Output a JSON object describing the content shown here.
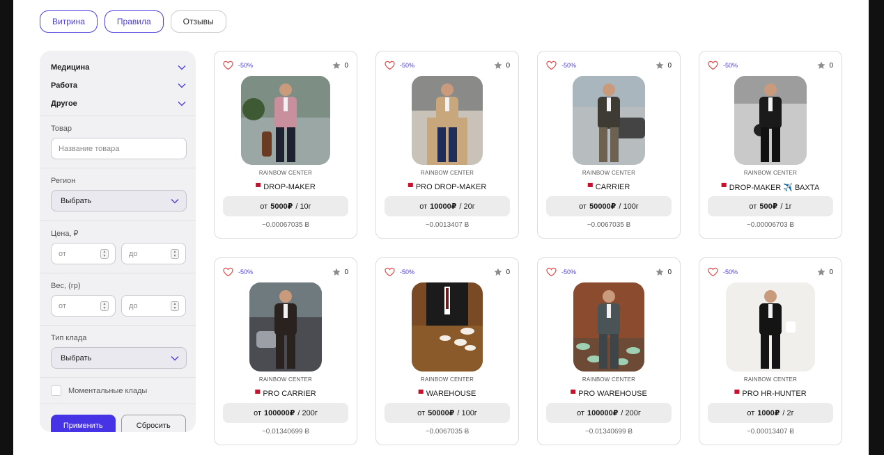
{
  "tabs": [
    {
      "label": "Витрина",
      "active": true
    },
    {
      "label": "Правила",
      "active": true
    },
    {
      "label": "Отзывы",
      "active": false
    }
  ],
  "sidebar": {
    "categories": [
      "Медицина",
      "Работа",
      "Другое"
    ],
    "product": {
      "label": "Товар",
      "placeholder": "Название товара"
    },
    "region": {
      "label": "Регион",
      "value": "Выбрать"
    },
    "price": {
      "label": "Цена, ₽",
      "from": "от",
      "to": "до"
    },
    "weight": {
      "label": "Вес, (гр)",
      "from": "от",
      "to": "до"
    },
    "stash_type": {
      "label": "Тип клада",
      "value": "Выбрать"
    },
    "instant": {
      "label": "Моментальные клады",
      "checked": false
    },
    "apply_label": "Применить",
    "reset_label": "Сбросить"
  },
  "products": [
    {
      "discount": "-50%",
      "rating": "0",
      "shop": "RAINBOW CENTER",
      "name": "DROP-MAKER",
      "price_prefix": "от",
      "price": "5000₽",
      "price_suffix": "/ 10г",
      "crypto": "~0.00067035 Ƀ",
      "photo": "man-pink-shirt"
    },
    {
      "discount": "-50%",
      "rating": "0",
      "shop": "RAINBOW CENTER",
      "name": "PRO DROP-MAKER",
      "price_prefix": "от",
      "price": "10000₽",
      "price_suffix": "/ 20г",
      "crypto": "~0.0013407 Ƀ",
      "photo": "man-beige-coat"
    },
    {
      "discount": "-50%",
      "rating": "0",
      "shop": "RAINBOW CENTER",
      "name": "CARRIER",
      "price_prefix": "от",
      "price": "50000₽",
      "price_suffix": "/ 100г",
      "crypto": "~0.0067035 Ƀ",
      "photo": "man-vest-car"
    },
    {
      "discount": "-50%",
      "rating": "0",
      "shop": "RAINBOW CENTER",
      "name": "DROP-MAKER ✈️ ВАХТА",
      "price_prefix": "от",
      "price": "500₽",
      "price_suffix": "/ 1г",
      "crypto": "~0.00006703 Ƀ",
      "photo": "man-black-street"
    },
    {
      "discount": "-50%",
      "rating": "0",
      "shop": "RAINBOW CENTER",
      "name": "PRO CARRIER",
      "price_prefix": "от",
      "price": "100000₽",
      "price_suffix": "/ 200г",
      "crypto": "~0.01340699 Ƀ",
      "photo": "man-dark-suit"
    },
    {
      "discount": "-50%",
      "rating": "0",
      "shop": "RAINBOW CENTER",
      "name": "WAREHOUSE",
      "price_prefix": "от",
      "price": "50000₽",
      "price_suffix": "/ 100г",
      "crypto": "~0.0067035 Ƀ",
      "photo": "table-coffee"
    },
    {
      "discount": "-50%",
      "rating": "0",
      "shop": "RAINBOW CENTER",
      "name": "PRO WAREHOUSE",
      "price_prefix": "от",
      "price": "100000₽",
      "price_suffix": "/ 200г",
      "crypto": "~0.01340699 Ƀ",
      "photo": "man-plaid-coffee"
    },
    {
      "discount": "-50%",
      "rating": "0",
      "shop": "RAINBOW CENTER",
      "name": "PRO HR-HUNTER",
      "price_prefix": "от",
      "price": "1000₽",
      "price_suffix": "/ 2г",
      "crypto": "~0.00013407 Ƀ",
      "photo": "man-phone-cup"
    }
  ],
  "colors": {
    "accent": "#4633e6",
    "discount": "#4b3ee0",
    "heart": "#e24b4b",
    "bag": "#c4122f"
  }
}
